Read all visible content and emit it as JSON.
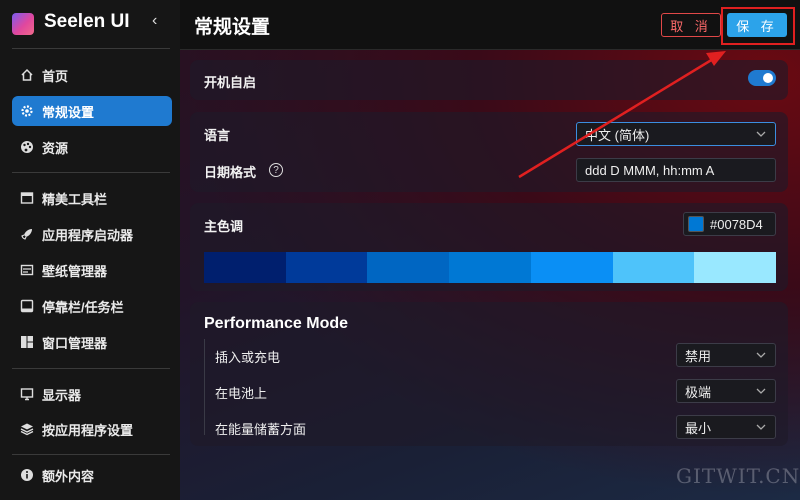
{
  "app": {
    "name": "Seelen UI",
    "collapse_icon": "chevron-left-icon"
  },
  "sidebar": {
    "groups": [
      [
        {
          "label": "首页",
          "icon": "home-icon"
        },
        {
          "label": "常规设置",
          "icon": "gear-icon",
          "active": true
        },
        {
          "label": "资源",
          "icon": "palette-icon"
        }
      ],
      [
        {
          "label": "精美工具栏",
          "icon": "toolbar-icon"
        },
        {
          "label": "应用程序启动器",
          "icon": "rocket-icon"
        },
        {
          "label": "壁纸管理器",
          "icon": "wallpaper-icon"
        },
        {
          "label": "停靠栏/任务栏",
          "icon": "dock-icon"
        },
        {
          "label": "窗口管理器",
          "icon": "window-manager-icon"
        }
      ],
      [
        {
          "label": "显示器",
          "icon": "monitor-icon"
        },
        {
          "label": "按应用程序设置",
          "icon": "layers-icon"
        }
      ],
      [
        {
          "label": "额外内容",
          "icon": "info-icon"
        }
      ]
    ]
  },
  "header": {
    "title": "常规设置",
    "cancel_label": "取 消",
    "save_label": "保 存"
  },
  "startup": {
    "label": "开机自启",
    "enabled": true
  },
  "locale": {
    "language_label": "语言",
    "language_value": "中文 (简体)",
    "date_format_label": "日期格式",
    "date_format_value": "ddd D MMM, hh:mm A"
  },
  "accent": {
    "label": "主色调",
    "hex": "#0078D4",
    "palette": [
      "#001f6e",
      "#003a9a",
      "#0066c2",
      "#0078d4",
      "#0a8ff5",
      "#4ec3fa",
      "#99e8ff"
    ]
  },
  "performance": {
    "title": "Performance Mode",
    "rows": [
      {
        "label": "插入或充电",
        "value": "禁用"
      },
      {
        "label": "在电池上",
        "value": "极端"
      },
      {
        "label": "在能量储蓄方面",
        "value": "最小"
      }
    ]
  },
  "watermark": "GITWIT.CN",
  "colors": {
    "accent": "#1f7ad0",
    "save": "#2ca3ea",
    "cancel": "#e04848",
    "annotation": "#e02020"
  }
}
